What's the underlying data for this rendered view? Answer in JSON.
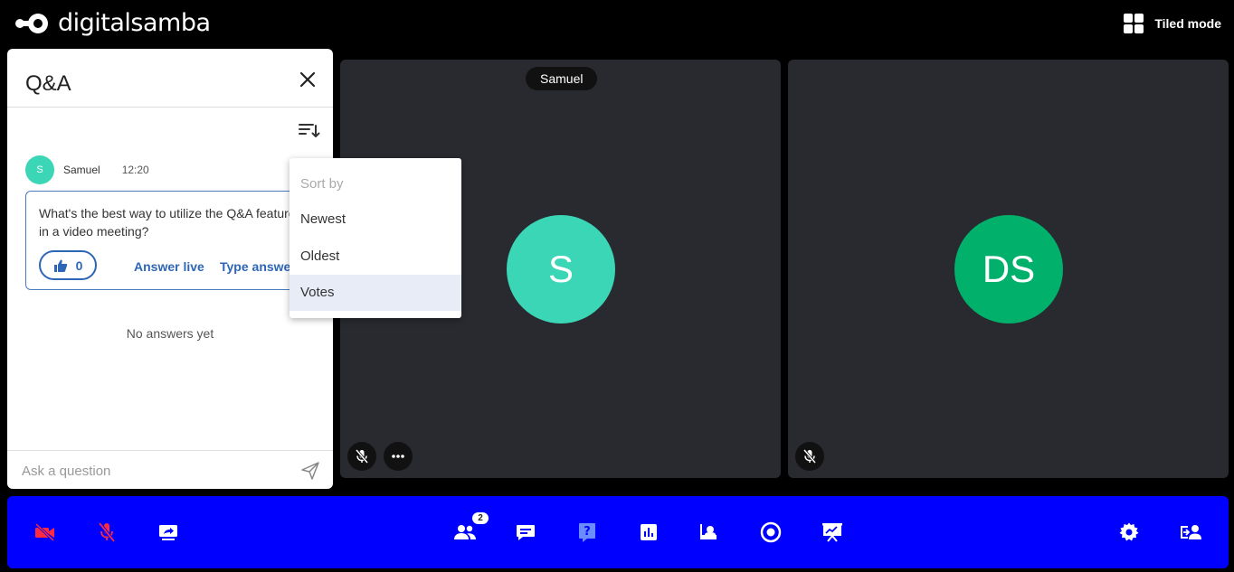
{
  "app": {
    "brand": "digitalsamba",
    "tiled_mode_label": "Tiled mode"
  },
  "qa": {
    "title": "Q&A",
    "question": {
      "author_initial": "S",
      "author_name": "Samuel",
      "time": "12:20",
      "text": "What's the best way to utilize the Q&A feature\nin a video meeting?",
      "votes": "0",
      "answer_live_label": "Answer live",
      "type_answer_label": "Type answer"
    },
    "no_answers_text": "No answers yet",
    "ask_placeholder": "Ask a question"
  },
  "sort_menu": {
    "header": "Sort by",
    "items": [
      "Newest",
      "Oldest",
      "Votes"
    ],
    "selected": "Votes"
  },
  "tiles": [
    {
      "name_tag": "Samuel",
      "initials": "S",
      "avatar_color": "#3bd6b5"
    },
    {
      "initials": "DS",
      "avatar_color": "#00b06b"
    }
  ],
  "toolbar": {
    "participants_count": "2"
  },
  "colors": {
    "toolbar_bg": "#0000ff",
    "muted_red": "#ff2a3d",
    "link_blue": "#2d66b7"
  }
}
